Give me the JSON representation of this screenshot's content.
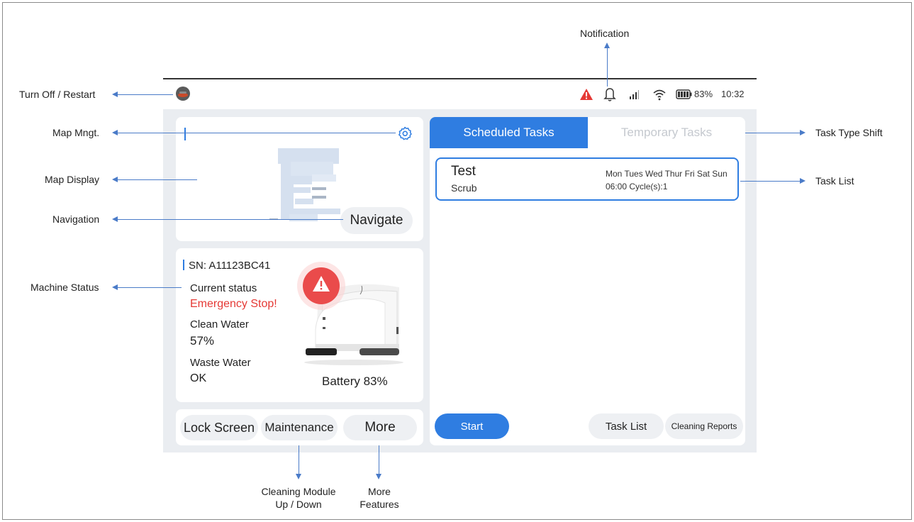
{
  "annotations": {
    "turn_off": "Turn Off / Restart",
    "map_mngt": "Map Mngt.",
    "map_display": "Map Display",
    "navigation": "Navigation",
    "machine_status": "Machine Status",
    "notification": "Notification",
    "task_type_shift": "Task Type Shift",
    "task_list": "Task List",
    "cleaning_module_line1": "Cleaning Module",
    "cleaning_module_line2": "Up / Down",
    "more_features_line1": "More",
    "more_features_line2": "Features"
  },
  "statusbar": {
    "battery_percent": "83%",
    "time": "10:32",
    "alert_color": "#e53935",
    "icons": [
      "avatar-icon",
      "warning-icon",
      "bell-icon",
      "signal-icon",
      "wifi-icon",
      "battery-icon"
    ]
  },
  "map_panel": {
    "navigate_label": "Navigate",
    "icons": [
      "gear-icon"
    ]
  },
  "status_panel": {
    "sn": "SN: A11123BC41",
    "current_status_label": "Current status",
    "current_status_value": "Emergency Stop!",
    "current_status_color": "#e53935",
    "clean_water_label": "Clean Water",
    "clean_water_value": "57%",
    "waste_water_label": "Waste Water",
    "waste_water_value": "OK",
    "battery": "Battery 83%"
  },
  "bottom_buttons": {
    "lock_screen": "Lock Screen",
    "maintenance": "Maintenance",
    "more": "More"
  },
  "tasks": {
    "tabs": [
      "Scheduled Tasks",
      "Temporary Tasks"
    ],
    "active_tab_color": "#2f7de1",
    "items": [
      {
        "name": "Test",
        "mode": "Scrub",
        "days": "Mon Tues Wed Thur Fri Sat Sun",
        "schedule": "06:00 Cycle(s):1"
      }
    ],
    "start_label": "Start",
    "task_list_label": "Task List",
    "cleaning_reports_label": "Cleaning Reports"
  }
}
